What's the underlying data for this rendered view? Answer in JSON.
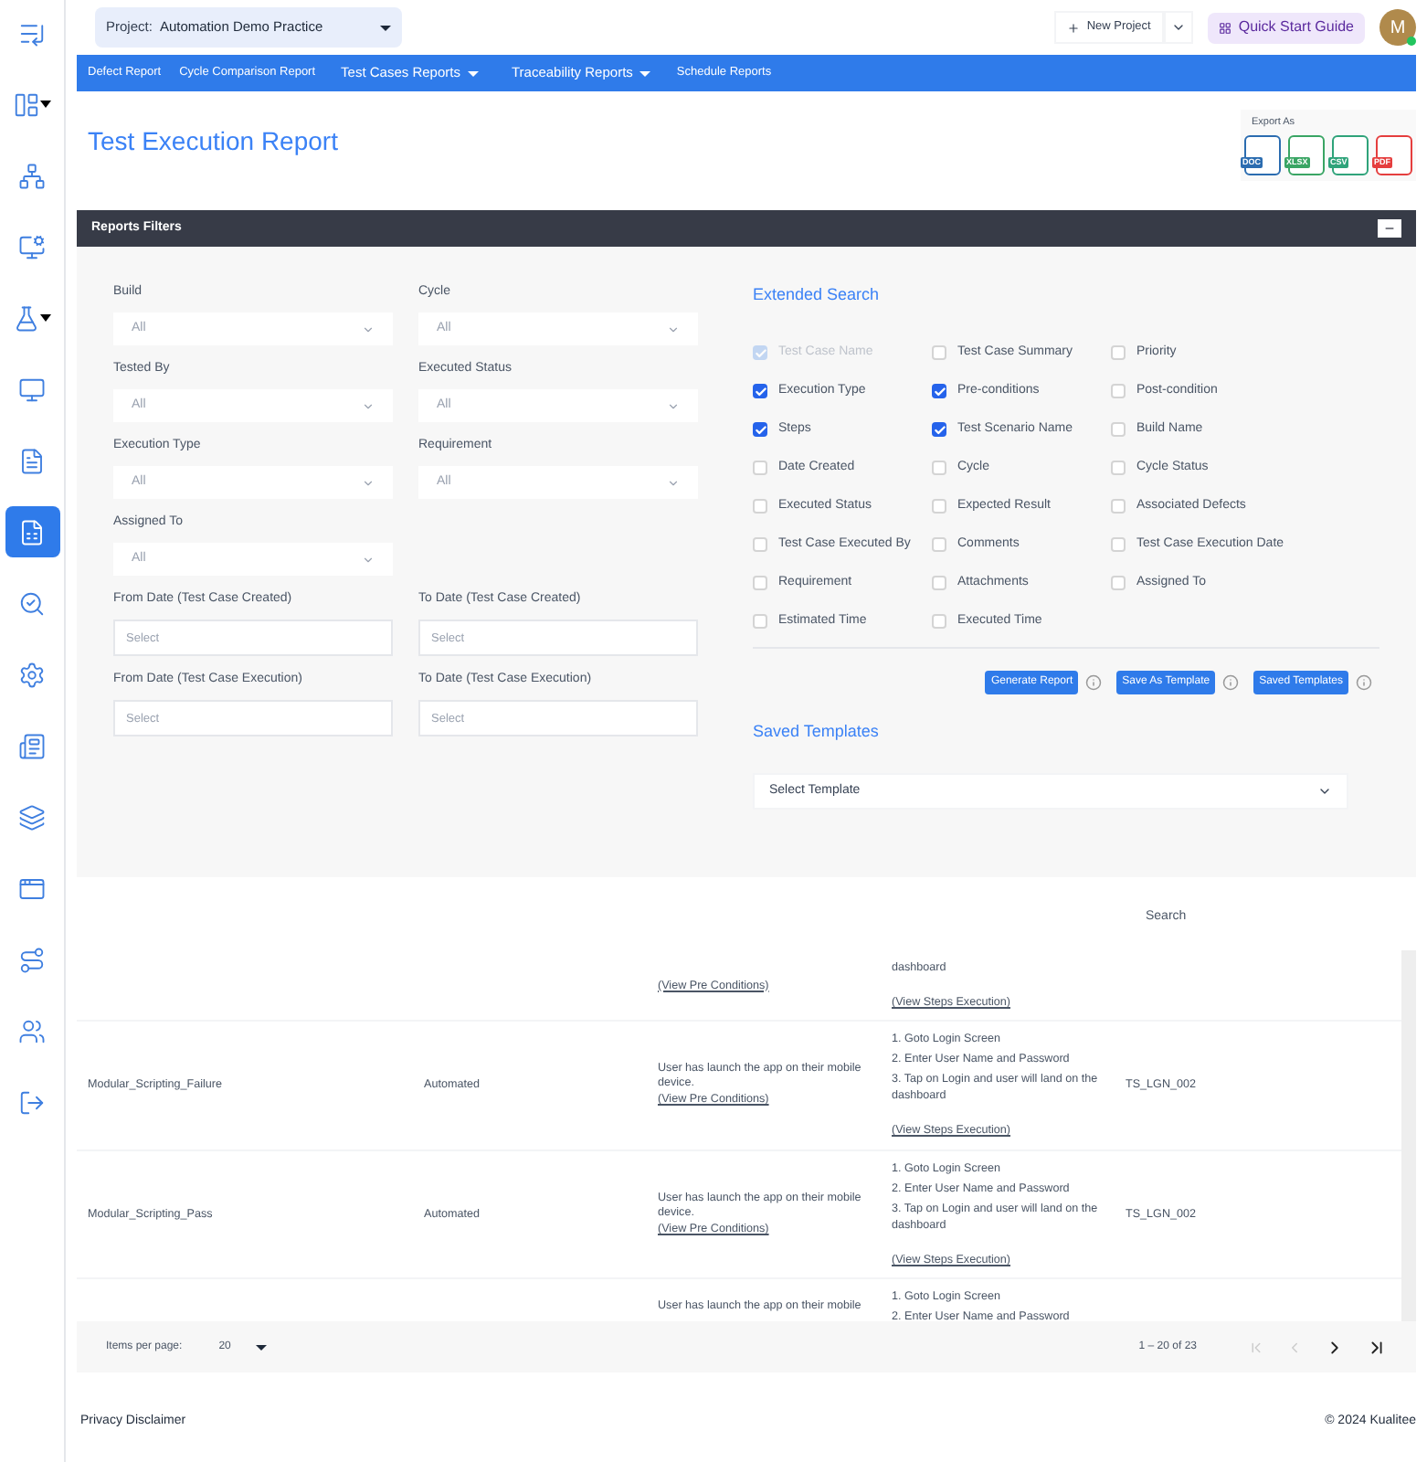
{
  "sidebar": {
    "items": [
      {
        "selected": false,
        "caret": false
      },
      {
        "selected": false,
        "caret": true
      },
      {
        "selected": false,
        "caret": false
      },
      {
        "selected": false,
        "caret": false
      },
      {
        "selected": false,
        "caret": true
      },
      {
        "selected": false,
        "caret": false
      },
      {
        "selected": false,
        "caret": false
      },
      {
        "selected": true,
        "caret": false
      },
      {
        "selected": false,
        "caret": false
      },
      {
        "selected": false,
        "caret": false
      },
      {
        "selected": false,
        "caret": false
      },
      {
        "selected": false,
        "caret": false
      },
      {
        "selected": false,
        "caret": false
      },
      {
        "selected": false,
        "caret": false
      },
      {
        "selected": false,
        "caret": false
      },
      {
        "selected": false,
        "caret": false
      }
    ]
  },
  "topbar": {
    "project_label": "Project:",
    "project": "Automation Demo Practice",
    "new_project": "New Project",
    "quick_start": "Quick Start Guide",
    "avatar": "M"
  },
  "nav": [
    {
      "label": "Defect Report",
      "dropdown": false
    },
    {
      "label": "Cycle Comparison Report",
      "dropdown": false
    },
    {
      "label": "Test Cases Reports",
      "dropdown": true
    },
    {
      "label": "Traceability Reports",
      "dropdown": true
    },
    {
      "label": "Schedule Reports",
      "dropdown": false
    }
  ],
  "title": "Test Execution Report",
  "export": {
    "label": "Export As",
    "formats": [
      {
        "label": "DOC",
        "color": "#2b6cb0"
      },
      {
        "label": "XLSX",
        "color": "#3aa564"
      },
      {
        "label": "CSV",
        "color": "#2fa37a"
      },
      {
        "label": "PDF",
        "color": "#e53e3e"
      }
    ]
  },
  "filters": {
    "header": "Reports Filters",
    "collapse": "−",
    "fields": [
      {
        "label": "Build",
        "kind": "select",
        "value": "All"
      },
      {
        "label": "Cycle",
        "kind": "select",
        "value": "All"
      },
      {
        "label": "Tested By",
        "kind": "select",
        "value": "All"
      },
      {
        "label": "Executed Status",
        "kind": "select",
        "value": "All"
      },
      {
        "label": "Execution Type",
        "kind": "select",
        "value": "All"
      },
      {
        "label": "Requirement",
        "kind": "select",
        "value": "All"
      },
      {
        "label": "Assigned To",
        "kind": "select",
        "value": "All"
      },
      {
        "kind": "spacer"
      },
      {
        "label": "From Date (Test Case Created)",
        "kind": "date",
        "placeholder": "Select"
      },
      {
        "label": "To Date (Test Case Created)",
        "kind": "date",
        "placeholder": "Select"
      },
      {
        "label": "From Date (Test Case Execution)",
        "kind": "date",
        "placeholder": "Select"
      },
      {
        "label": "To Date (Test Case Execution)",
        "kind": "date",
        "placeholder": "Select"
      }
    ],
    "extended_title": "Extended Search",
    "options": [
      {
        "label": "Test Case Name",
        "checked": true,
        "disabled": true
      },
      {
        "label": "Test Case Summary",
        "checked": false,
        "disabled": false
      },
      {
        "label": "Priority",
        "checked": false,
        "disabled": false
      },
      {
        "label": "Execution Type",
        "checked": true,
        "disabled": false
      },
      {
        "label": "Pre-conditions",
        "checked": true,
        "disabled": false
      },
      {
        "label": "Post-condition",
        "checked": false,
        "disabled": false
      },
      {
        "label": "Steps",
        "checked": true,
        "disabled": false
      },
      {
        "label": "Test Scenario Name",
        "checked": true,
        "disabled": false
      },
      {
        "label": "Build Name",
        "checked": false,
        "disabled": false
      },
      {
        "label": "Date Created",
        "checked": false,
        "disabled": false
      },
      {
        "label": "Cycle",
        "checked": false,
        "disabled": false
      },
      {
        "label": "Cycle Status",
        "checked": false,
        "disabled": false
      },
      {
        "label": "Executed Status",
        "checked": false,
        "disabled": false
      },
      {
        "label": "Expected Result",
        "checked": false,
        "disabled": false
      },
      {
        "label": "Associated Defects",
        "checked": false,
        "disabled": false
      },
      {
        "label": "Test Case Executed By",
        "checked": false,
        "disabled": false
      },
      {
        "label": "Comments",
        "checked": false,
        "disabled": false
      },
      {
        "label": "Test Case Execution Date",
        "checked": false,
        "disabled": false
      },
      {
        "label": "Requirement",
        "checked": false,
        "disabled": false
      },
      {
        "label": "Attachments",
        "checked": false,
        "disabled": false
      },
      {
        "label": "Assigned To",
        "checked": false,
        "disabled": false
      },
      {
        "label": "Estimated Time",
        "checked": false,
        "disabled": false
      },
      {
        "label": "Executed Time",
        "checked": false,
        "disabled": false
      }
    ],
    "buttons": [
      "Generate Report",
      "Save As Template",
      "Saved Templates"
    ],
    "templates_title": "Saved Templates",
    "template_select": "Select Template"
  },
  "table": {
    "search_placeholder": "Search",
    "rows": [
      {
        "pre_link": "(View Pre Conditions)",
        "steps": [
          "dashboard"
        ],
        "steps_link": "(View Steps Execution)"
      },
      {
        "name": "Modular_Scripting_Failure",
        "type": "Automated",
        "precondition": "User has launch the app on their mobile device.",
        "pre_link": "(View Pre Conditions)",
        "steps": [
          "1. Goto Login Screen",
          "2. Enter User Name and Password",
          "3. Tap on Login and user will land on the dashboard"
        ],
        "steps_link": "(View Steps Execution)",
        "scenario": "TS_LGN_002"
      },
      {
        "name": "Modular_Scripting_Pass",
        "type": "Automated",
        "precondition": "User has launch the app on their mobile device.",
        "pre_link": "(View Pre Conditions)",
        "steps": [
          "1. Goto Login Screen",
          "2. Enter User Name and Password",
          "3. Tap on Login and user will land on the dashboard"
        ],
        "steps_link": "(View Steps Execution)",
        "scenario": "TS_LGN_002"
      },
      {
        "precondition": "User has launch the app on their mobile",
        "steps": [
          "1. Goto Login Screen",
          "2. Enter User Name and Password"
        ]
      }
    ]
  },
  "pagination": {
    "label": "Items per page:",
    "per_page": "20",
    "range": "1 – 20 of 23"
  },
  "footer": {
    "left": "Privacy Disclaimer",
    "right": "© 2024 Kualitee"
  }
}
